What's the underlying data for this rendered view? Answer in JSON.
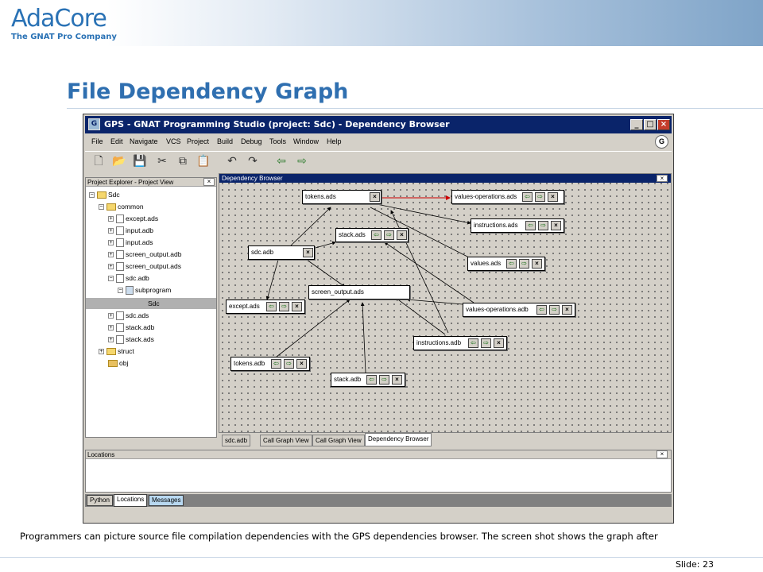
{
  "logo": {
    "name": "AdaCore",
    "tagline": "The GNAT Pro Company"
  },
  "slide": {
    "title": "File Dependency Graph",
    "caption": "Programmers can picture source file compilation dependencies with the GPS dependencies browser. The screen shot shows the graph after",
    "number": "Slide: 23"
  },
  "window": {
    "title": "GPS - GNAT Programming Studio (project: Sdc) - Dependency Browser",
    "menu": [
      "File",
      "Edit",
      "Navigate",
      "VCS",
      "Project",
      "Build",
      "Debug",
      "Tools",
      "Window",
      "Help"
    ]
  },
  "project_view": {
    "header": "Project Explorer - Project View",
    "items": [
      {
        "label": "Sdc"
      },
      {
        "label": "common"
      },
      {
        "label": "except.ads"
      },
      {
        "label": "input.adb"
      },
      {
        "label": "input.ads"
      },
      {
        "label": "screen_output.adb"
      },
      {
        "label": "screen_output.ads"
      },
      {
        "label": "sdc.adb"
      },
      {
        "label": "subprogram"
      },
      {
        "label": "Sdc"
      },
      {
        "label": "sdc.ads"
      },
      {
        "label": "stack.adb"
      },
      {
        "label": "stack.ads"
      },
      {
        "label": "struct"
      },
      {
        "label": "obj"
      }
    ]
  },
  "dependency_browser": {
    "header": "Dependency Browser",
    "nodes": [
      {
        "label": "tokens.ads"
      },
      {
        "label": "values-operations.ads"
      },
      {
        "label": "instructions.ads"
      },
      {
        "label": "stack.ads"
      },
      {
        "label": "sdc.adb"
      },
      {
        "label": "values.ads"
      },
      {
        "label": "screen_output.ads"
      },
      {
        "label": "except.ads"
      },
      {
        "label": "values-operations.adb"
      },
      {
        "label": "instructions.adb"
      },
      {
        "label": "tokens.adb"
      },
      {
        "label": "stack.adb"
      }
    ],
    "tabs": [
      "sdc.adb",
      "Call Graph View",
      "Call Graph View",
      "Dependency Browser"
    ]
  },
  "locations": {
    "header": "Locations",
    "tabs": [
      "Python",
      "Locations",
      "Messages"
    ]
  }
}
